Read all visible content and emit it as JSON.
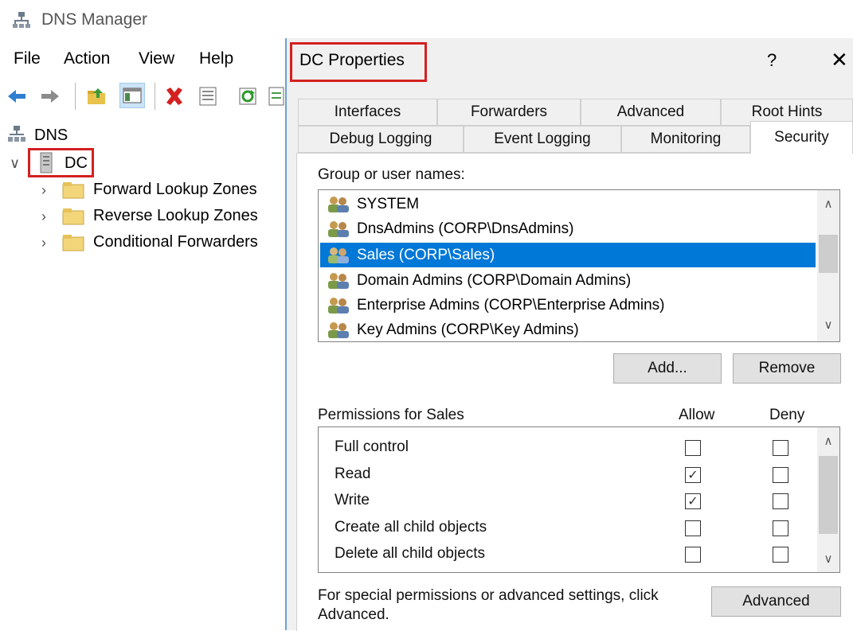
{
  "app": {
    "title": "DNS Manager",
    "menu": [
      "File",
      "Action",
      "View",
      "Help"
    ]
  },
  "toolbar": {
    "icons": [
      "back-icon",
      "forward-icon",
      "up-folder-icon",
      "show-hide-console-tree-icon",
      "delete-icon",
      "properties-icon",
      "refresh-icon",
      "export-list-icon"
    ]
  },
  "tree": {
    "root": "DNS",
    "server": "DC",
    "children": [
      "Forward Lookup Zones",
      "Reverse Lookup Zones",
      "Conditional Forwarders"
    ]
  },
  "dialog": {
    "title": "DC Properties",
    "help": "?",
    "close": "✕",
    "tabs_row1": [
      "Interfaces",
      "Forwarders",
      "Advanced",
      "Root Hints"
    ],
    "tabs_row2": [
      "Debug Logging",
      "Event Logging",
      "Monitoring",
      "Security"
    ],
    "selected_tab": "Security",
    "group_label": "Group or user names:",
    "users": [
      "SYSTEM",
      "DnsAdmins (CORP\\DnsAdmins)",
      "Sales (CORP\\Sales)",
      "Domain Admins (CORP\\Domain Admins)",
      "Enterprise Admins (CORP\\Enterprise Admins)",
      "Key Admins (CORP\\Key Admins)"
    ],
    "selected_user": "Sales (CORP\\Sales)",
    "add_button": "Add...",
    "remove_button": "Remove",
    "permissions_label": "Permissions for Sales",
    "allow_header": "Allow",
    "deny_header": "Deny",
    "permissions": [
      {
        "name": "Full control",
        "allow": false,
        "deny": false
      },
      {
        "name": "Read",
        "allow": true,
        "deny": false
      },
      {
        "name": "Write",
        "allow": true,
        "deny": false
      },
      {
        "name": "Create all child objects",
        "allow": false,
        "deny": false
      },
      {
        "name": "Delete all child objects",
        "allow": false,
        "deny": false
      }
    ],
    "special_text_line1": "For special permissions or advanced settings, click",
    "special_text_line2": "Advanced.",
    "advanced_button": "Advanced"
  },
  "colors": {
    "selection": "#0078d7",
    "highlight_box": "#d32020"
  }
}
